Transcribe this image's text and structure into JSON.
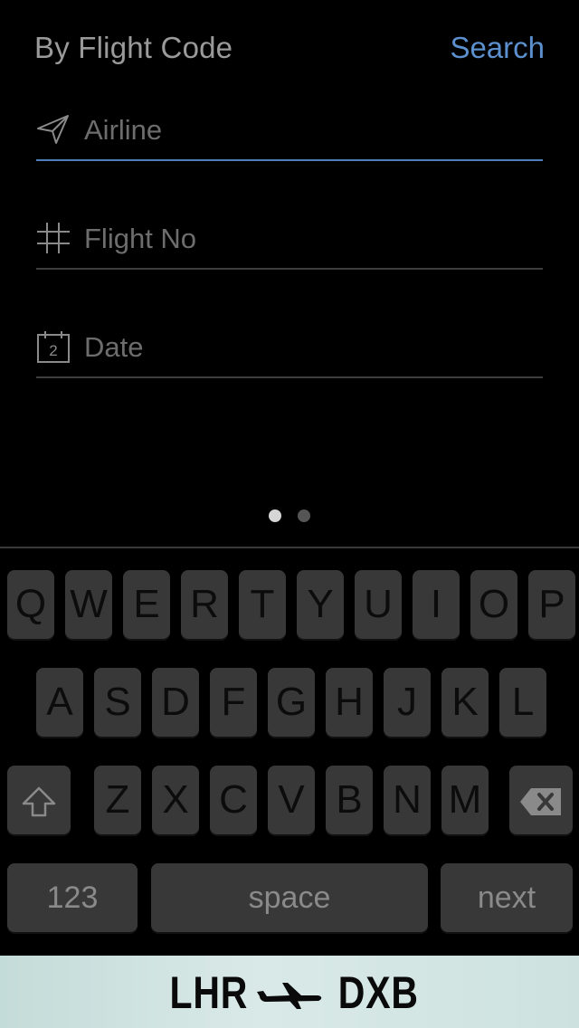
{
  "header": {
    "title": "By Flight Code",
    "search_label": "Search"
  },
  "fields": {
    "airline": {
      "label": "Airline",
      "icon": "paper-plane-icon"
    },
    "flight_no": {
      "label": "Flight No",
      "icon": "hash-icon"
    },
    "date": {
      "label": "Date",
      "icon": "calendar-icon",
      "icon_number": "2"
    }
  },
  "pager": {
    "total": 2,
    "active": 1
  },
  "keyboard": {
    "row1": [
      "Q",
      "W",
      "E",
      "R",
      "T",
      "Y",
      "U",
      "I",
      "O",
      "P"
    ],
    "row2": [
      "A",
      "S",
      "D",
      "F",
      "G",
      "H",
      "J",
      "K",
      "L"
    ],
    "row3": [
      "Z",
      "X",
      "C",
      "V",
      "B",
      "N",
      "M"
    ],
    "shift_icon": "shift-arrow-icon",
    "delete_icon": "backspace-icon",
    "numbers_label": "123",
    "space_label": "space",
    "next_label": "next"
  },
  "banner": {
    "origin": "LHR",
    "destination": "DXB",
    "icon": "airplane-icon"
  }
}
